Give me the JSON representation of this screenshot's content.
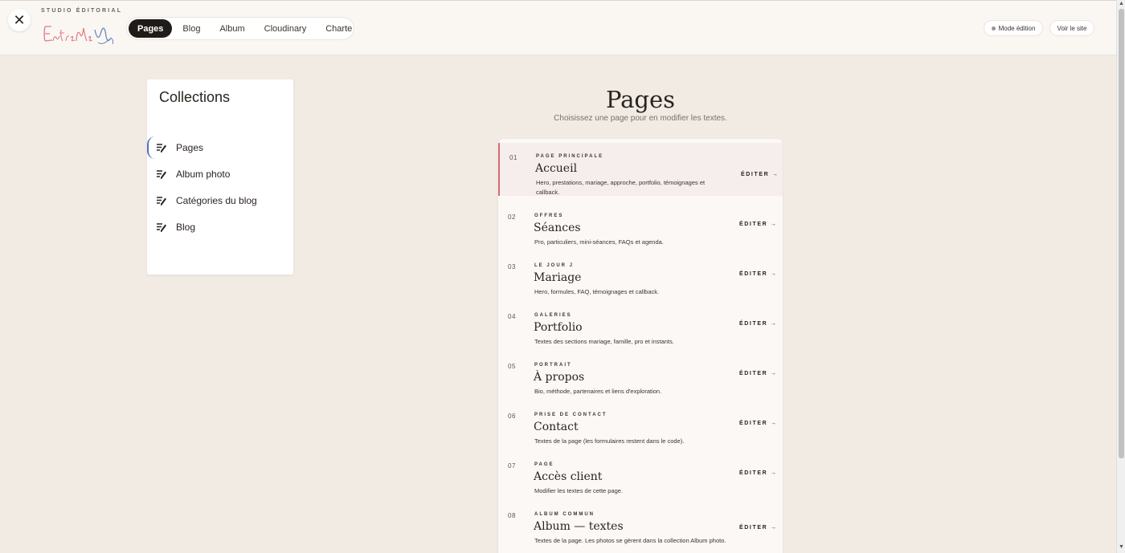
{
  "header": {
    "close_symbol": "✕",
    "brand_kicker": "STUDIO ÉDITORIAL",
    "logo_text": "EntreMeVous",
    "tabs": [
      {
        "label": "Pages",
        "active": true
      },
      {
        "label": "Blog",
        "active": false
      },
      {
        "label": "Album",
        "active": false
      },
      {
        "label": "Cloudinary",
        "active": false
      },
      {
        "label": "Charte",
        "active": false
      }
    ],
    "mode_label": "Mode édition",
    "site_label": "Voir le site"
  },
  "sidebar": {
    "title": "Collections",
    "items": [
      {
        "label": "Pages",
        "icon": "edit-list-icon",
        "active": true
      },
      {
        "label": "Album photo",
        "icon": "edit-list-icon",
        "active": false
      },
      {
        "label": "Catégories du blog",
        "icon": "edit-list-icon",
        "active": false
      },
      {
        "label": "Blog",
        "icon": "edit-list-icon",
        "active": false
      }
    ]
  },
  "main": {
    "title": "Pages",
    "subtitle": "Choisissez une page pour en modifier les textes.",
    "edit_label": "ÉDITER →",
    "pages": [
      {
        "num": "01",
        "kicker": "PAGE PRINCIPALE",
        "title": "Accueil",
        "desc": "Hero, prestations, mariage, approche, portfolio, témoignages et callback.",
        "active": true
      },
      {
        "num": "02",
        "kicker": "OFFRES",
        "title": "Séances",
        "desc": "Pro, particuliers, mini-séances, FAQs et agenda.",
        "active": false
      },
      {
        "num": "03",
        "kicker": "LE JOUR J",
        "title": "Mariage",
        "desc": "Hero, formules, FAQ, témoignages et callback.",
        "active": false
      },
      {
        "num": "04",
        "kicker": "GALERIES",
        "title": "Portfolio",
        "desc": "Textes des sections mariage, famille, pro et instants.",
        "active": false
      },
      {
        "num": "05",
        "kicker": "PORTRAIT",
        "title": "À propos",
        "desc": "Bio, méthode, partenaires et liens d'exploration.",
        "active": false
      },
      {
        "num": "06",
        "kicker": "PRISE DE CONTACT",
        "title": "Contact",
        "desc": "Textes de la page (les formulaires restent dans le code).",
        "active": false
      },
      {
        "num": "07",
        "kicker": "PAGE",
        "title": "Accès client",
        "desc": "Modifier les textes de cette page.",
        "active": false
      },
      {
        "num": "08",
        "kicker": "ALBUM COMMUN",
        "title": "Album — textes",
        "desc": "Textes de la page. Les photos se gèrent dans la collection Album photo.",
        "active": false
      }
    ]
  },
  "colors": {
    "accent_active_row": "#d86a72",
    "active_tab_bg": "#1f1b18",
    "sidebar_active": "#5a6fbf",
    "logo_pink": "#e07a86",
    "logo_blue": "#6a86c4"
  }
}
